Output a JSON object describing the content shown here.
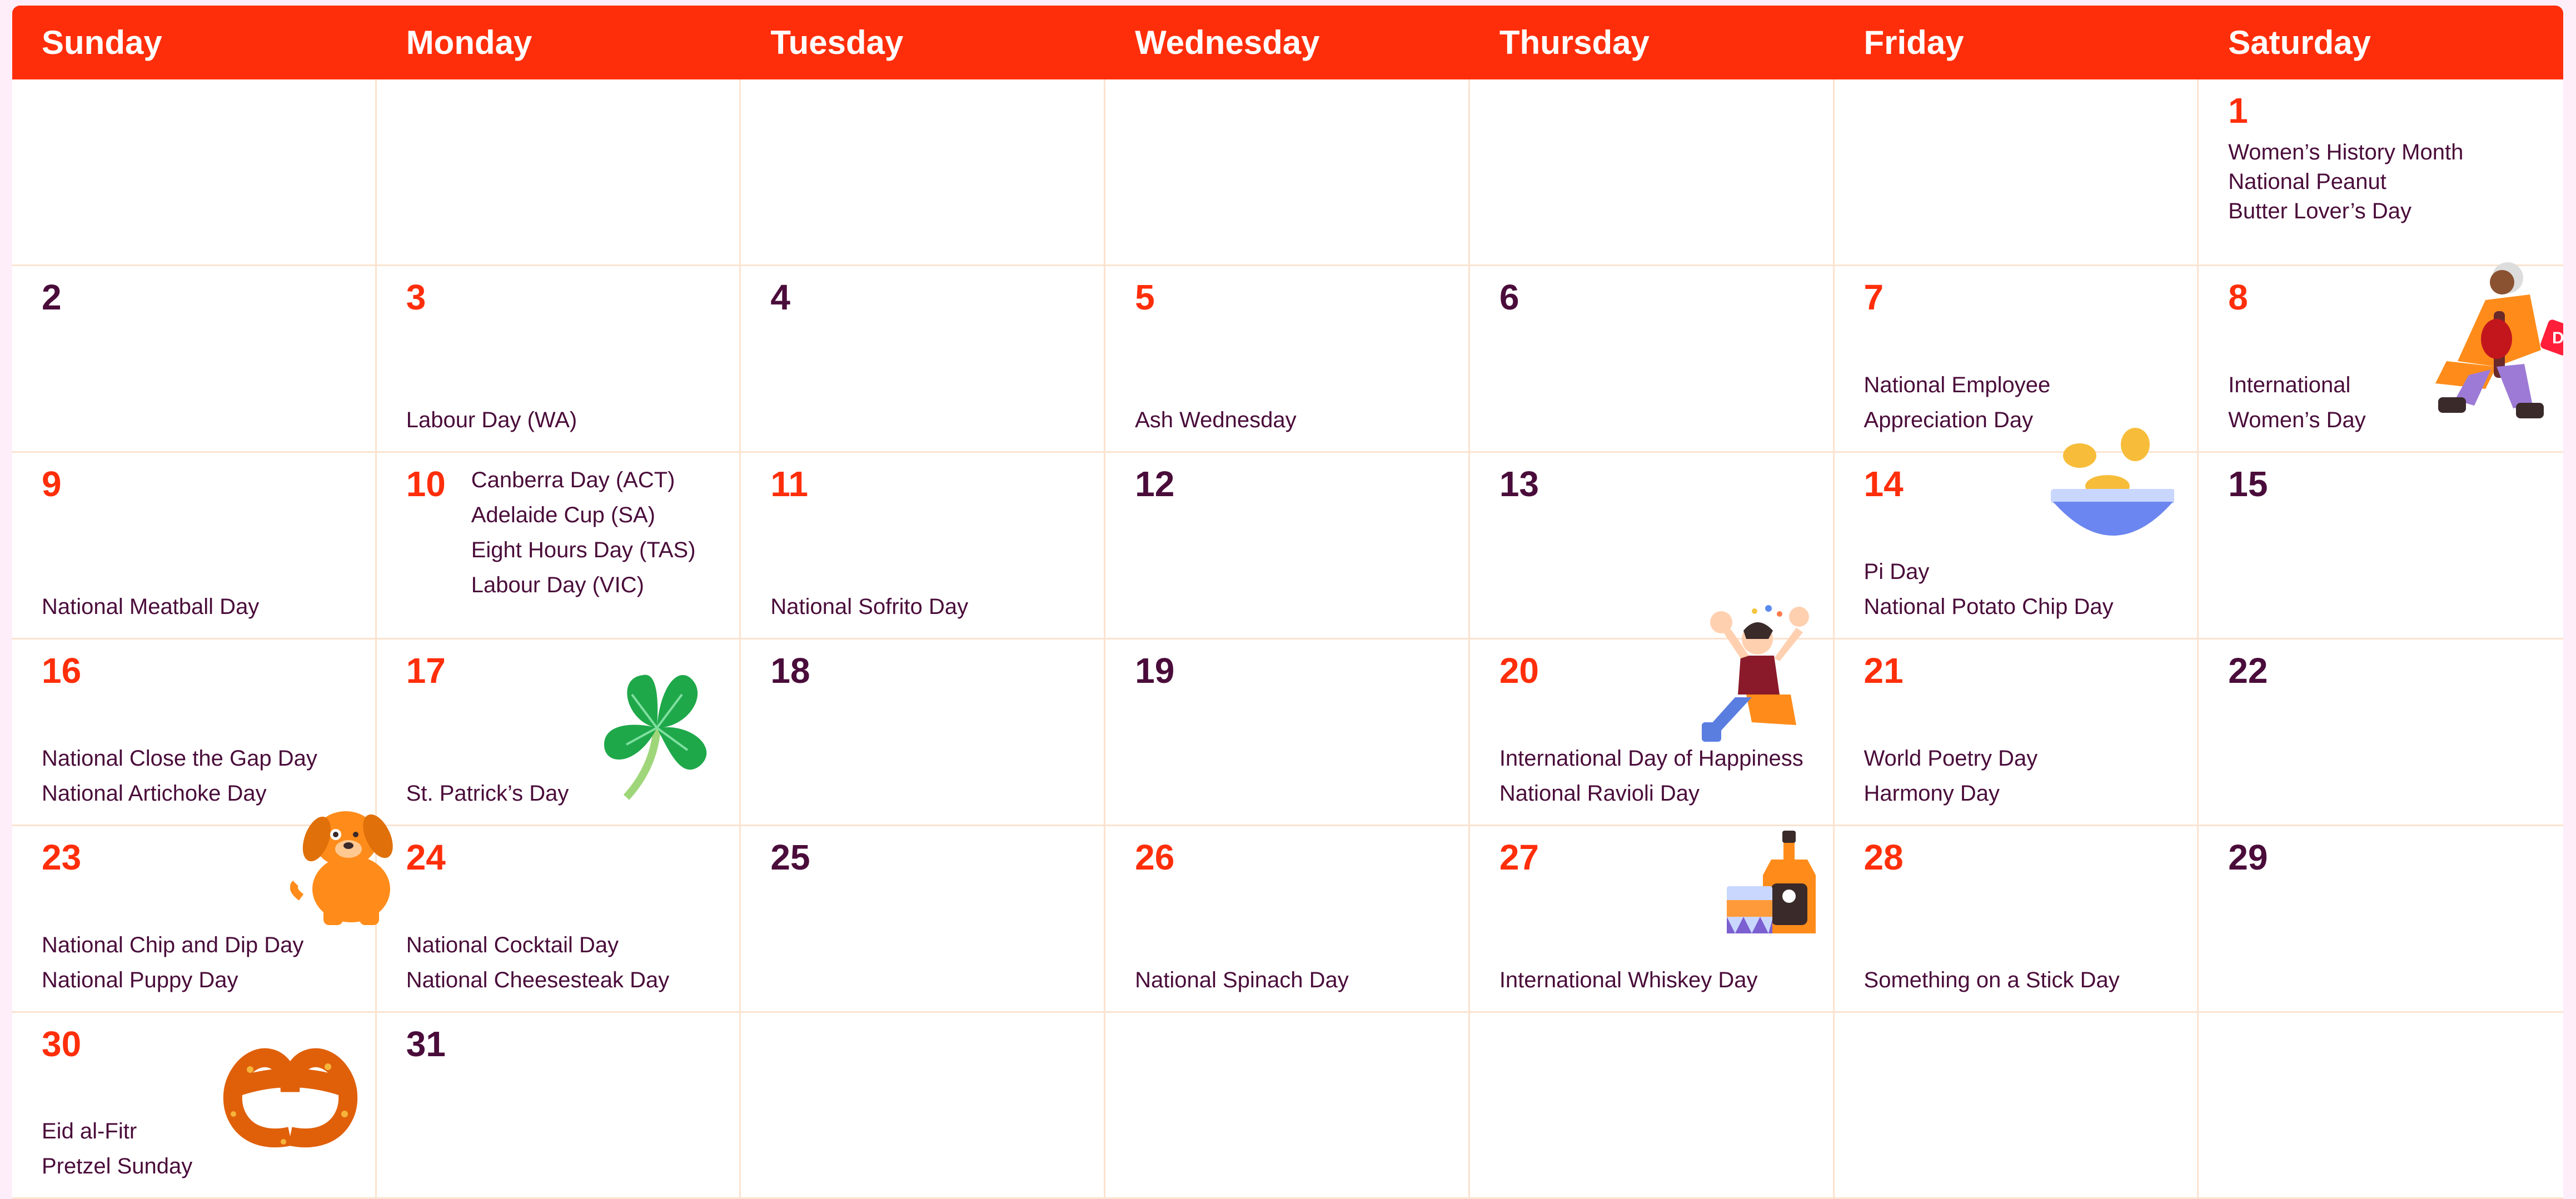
{
  "days": [
    "Sunday",
    "Monday",
    "Tuesday",
    "Wednesday",
    "Thursday",
    "Friday",
    "Saturday"
  ],
  "cells": [
    {
      "day": "",
      "red": false,
      "events": []
    },
    {
      "day": "",
      "red": false,
      "events": []
    },
    {
      "day": "",
      "red": false,
      "events": []
    },
    {
      "day": "",
      "red": false,
      "events": []
    },
    {
      "day": "",
      "red": false,
      "events": []
    },
    {
      "day": "",
      "red": false,
      "events": []
    },
    {
      "day": "1",
      "red": true,
      "events": [
        "Women’s History Month",
        "National Peanut",
        "Butter Lover’s Day"
      ]
    },
    {
      "day": "2",
      "red": false,
      "events": []
    },
    {
      "day": "3",
      "red": true,
      "events": [
        "Labour Day (WA)"
      ]
    },
    {
      "day": "4",
      "red": false,
      "events": []
    },
    {
      "day": "5",
      "red": true,
      "events": [
        "Ash Wednesday"
      ]
    },
    {
      "day": "6",
      "red": false,
      "events": []
    },
    {
      "day": "7",
      "red": true,
      "events": [
        "National Employee",
        "Appreciation Day"
      ]
    },
    {
      "day": "8",
      "red": true,
      "events": [
        "International",
        "Women’s Day"
      ]
    },
    {
      "day": "9",
      "red": true,
      "events": [
        "National Meatball Day"
      ]
    },
    {
      "day": "10",
      "red": true,
      "events": [
        "Canberra Day (ACT)",
        "Adelaide Cup (SA)",
        "Eight Hours Day (TAS)",
        "Labour Day (VIC)"
      ]
    },
    {
      "day": "11",
      "red": true,
      "events": [
        "National Sofrito Day"
      ]
    },
    {
      "day": "12",
      "red": false,
      "events": []
    },
    {
      "day": "13",
      "red": false,
      "events": []
    },
    {
      "day": "14",
      "red": true,
      "events": [
        "Pi Day",
        "National Potato Chip Day"
      ]
    },
    {
      "day": "15",
      "red": false,
      "events": []
    },
    {
      "day": "16",
      "red": true,
      "events": [
        "National Close the Gap Day",
        "National Artichoke Day"
      ]
    },
    {
      "day": "17",
      "red": true,
      "events": [
        "St. Patrick’s Day"
      ]
    },
    {
      "day": "18",
      "red": false,
      "events": []
    },
    {
      "day": "19",
      "red": false,
      "events": []
    },
    {
      "day": "20",
      "red": true,
      "events": [
        "International Day of Happiness",
        "National Ravioli Day"
      ]
    },
    {
      "day": "21",
      "red": true,
      "events": [
        "World Poetry Day",
        "Harmony Day"
      ]
    },
    {
      "day": "22",
      "red": false,
      "events": []
    },
    {
      "day": "23",
      "red": true,
      "events": [
        "National Chip and Dip Day",
        "National Puppy Day"
      ]
    },
    {
      "day": "24",
      "red": true,
      "events": [
        "National Cocktail Day",
        "National Cheesesteak Day"
      ]
    },
    {
      "day": "25",
      "red": false,
      "events": []
    },
    {
      "day": "26",
      "red": true,
      "events": [
        "National Spinach Day"
      ]
    },
    {
      "day": "27",
      "red": true,
      "events": [
        "International Whiskey Day"
      ]
    },
    {
      "day": "28",
      "red": true,
      "events": [
        "Something on a Stick Day"
      ]
    },
    {
      "day": "29",
      "red": false,
      "events": []
    },
    {
      "day": "30",
      "red": true,
      "events": [
        "Eid al-Fitr",
        "Pretzel Sunday"
      ]
    },
    {
      "day": "31",
      "red": false,
      "events": []
    },
    {
      "day": "",
      "red": false,
      "events": []
    },
    {
      "day": "",
      "red": false,
      "events": []
    },
    {
      "day": "",
      "red": false,
      "events": []
    },
    {
      "day": "",
      "red": false,
      "events": []
    },
    {
      "day": "",
      "red": false,
      "events": []
    }
  ],
  "illustrations": [
    "shopper-illustration",
    "potato-chips-bowl-illustration",
    "happy-person-illustration",
    "shamrock-icon",
    "puppy-illustration",
    "whiskey-bottle-illustration",
    "pretzel-illustration"
  ],
  "colors": {
    "header": "#ff2e0a",
    "red_number": "#ff2e0a",
    "dark_text": "#4a0c3a",
    "grid_line": "#fbe3cf",
    "page_bg": "#fdeefa"
  }
}
